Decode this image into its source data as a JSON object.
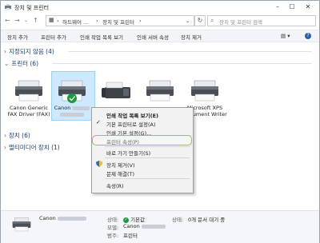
{
  "window": {
    "title": "장치 및 프린터"
  },
  "address": {
    "segments": [
      "하드웨어 ...",
      "장치 및 프린터"
    ],
    "search_placeholder": "장치 및 프린터 검색"
  },
  "toolbar": {
    "items": [
      "장치 추가",
      "프린터 추가",
      "인쇄 작업 목록 보기",
      "인쇄 서버 속성",
      "장치 제거"
    ]
  },
  "groups": {
    "unspecified": "지정되지 않음 (4)",
    "printers": "프린터 (6)",
    "devices": "장치 (6)",
    "multimedia": "멀티미디어 장치 (1)"
  },
  "devices": [
    {
      "label": "Canon Generic FAX Driver (FAX)"
    },
    {
      "label": "Canon"
    },
    {
      "label": ""
    },
    {
      "label": ""
    },
    {
      "label": "Microsoft XPS Document Writer"
    }
  ],
  "context_menu": {
    "items": [
      "인쇄 작업 목록 보기(E)",
      "기본 프린터로 설정(A)",
      "인쇄 기본 설정(G)...",
      "프린터 속성(P)",
      "바로 가기 만들기(S)",
      "장치 제거(V)",
      "문제 해결(T)",
      "속성(R)"
    ]
  },
  "details": {
    "name": "Canon",
    "status_label": "상태:",
    "status_value": "기본값",
    "model_label": "모델:",
    "model_value": "Canon",
    "category_label": "범주:",
    "category_value": "프린터",
    "queue_label": "상태:",
    "queue_value": "0개 문서 대기 중"
  },
  "colors": {
    "accent": "#0078d7",
    "selection": "#cde8ff",
    "highlight": "#f0a020",
    "group_text": "#1a3e7a"
  }
}
